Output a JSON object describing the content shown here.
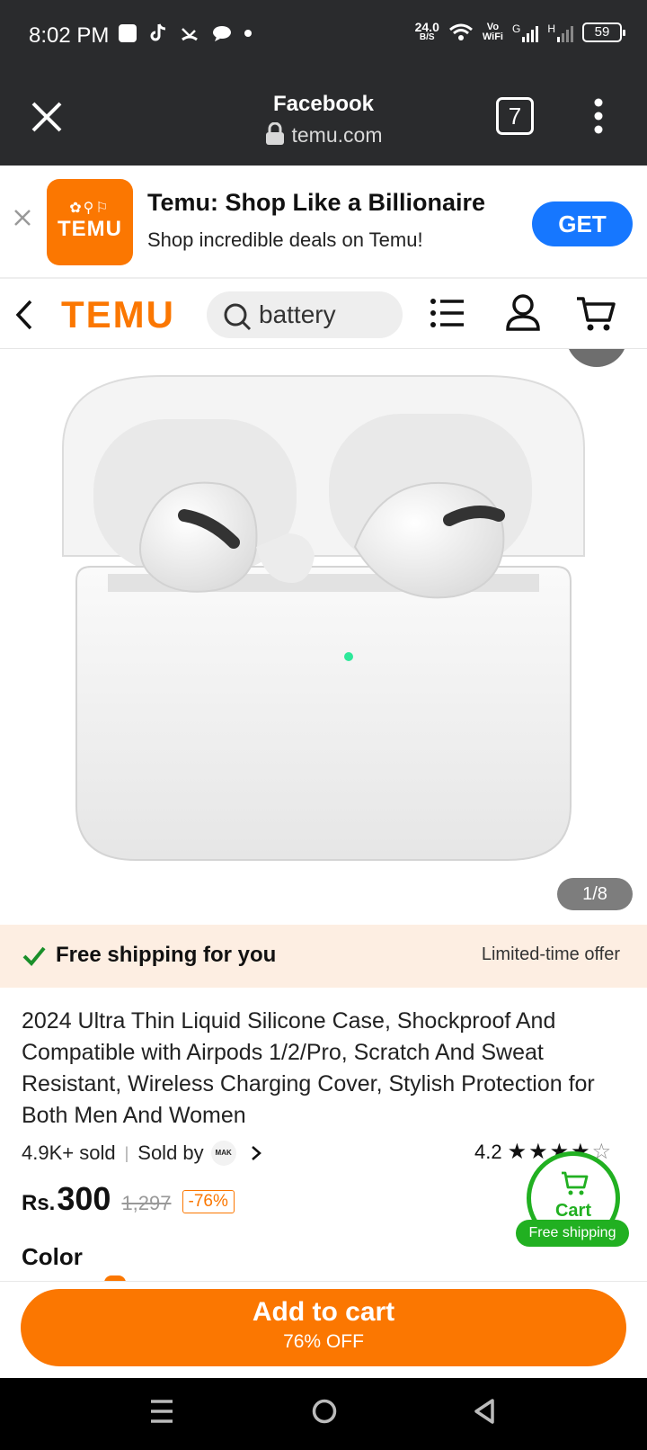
{
  "status_bar": {
    "time": "8:02 PM",
    "speed_value": "24.0",
    "speed_unit": "B/S",
    "vowifi_top": "Vo",
    "vowifi_bottom": "WiFi",
    "net1": "G",
    "net2": "H",
    "battery": "59"
  },
  "browser": {
    "title": "Facebook",
    "url": "temu.com",
    "tab_count": "7"
  },
  "banner": {
    "app_title": "Temu: Shop Like a Billionaire",
    "subtitle": "Shop incredible deals on Temu!",
    "logo_text": "TEMU",
    "get_label": "GET"
  },
  "nav": {
    "logo": "TEMU",
    "search_value": "battery"
  },
  "gallery": {
    "pager": "1/8"
  },
  "shipping": {
    "text": "Free shipping for you",
    "offer": "Limited-time offer"
  },
  "product": {
    "title": "2024 Ultra Thin Liquid Silicone Case, Shockproof And Compatible with Airpods 1/2/Pro, Scratch And Sweat Resistant, Wireless Charging Cover, Stylish Protection for Both Men And Women",
    "sold": "4.9K+ sold",
    "sold_by": "Sold by",
    "seller_logo": "MAK",
    "rating": "4.2",
    "stars": 4.2,
    "currency": "Rs.",
    "price": "300",
    "original_price": "1,297",
    "discount": "-76%",
    "color_label": "Color"
  },
  "cart_float": {
    "label": "Cart",
    "free_shipping": "Free shipping"
  },
  "footer": {
    "add_to_cart": "Add to cart",
    "off": "76% OFF"
  },
  "colors": {
    "brand_orange": "#fb7701",
    "get_blue": "#1677ff",
    "green": "#21b021"
  }
}
